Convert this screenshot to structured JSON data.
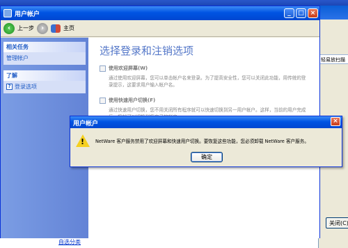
{
  "window": {
    "title": "用户帐户"
  },
  "toolbar": {
    "back_label": "上一步",
    "home_label": "主页"
  },
  "sidebar": {
    "related_tasks": {
      "header": "相关任务",
      "items": [
        "管理帐户"
      ]
    },
    "learn": {
      "header": "了解",
      "items": [
        "登录选项"
      ]
    }
  },
  "main": {
    "title": "选择登录和注销选项",
    "option1": {
      "label": "使用欢迎屏幕(W)",
      "desc": "通过使用欢迎屏幕，您可以单击帐户名来登录。为了提高安全性，您可以关闭此功能，用传统的登录提示，这要求用户输入帐户名。"
    },
    "option2": {
      "label": "使用快速用户切换(F)",
      "desc": "通过快速用户切换，您不用关闭所有程序就可以快速切换到另一用户帐户。这样，当前的用户完成后，您就可以切换到您自己的帐户。"
    }
  },
  "dialog": {
    "title": "用户帐户",
    "message": "NetWare 客户服务禁用了欢迎屏幕和快速用户切换。要恢复这些功能，您必须卸载 NetWare 客户服务。",
    "ok_label": "确定"
  },
  "background": {
    "panel_text": "轻易放扫描",
    "close_label": "关闭(C)",
    "bottom_link": "自选分类"
  }
}
